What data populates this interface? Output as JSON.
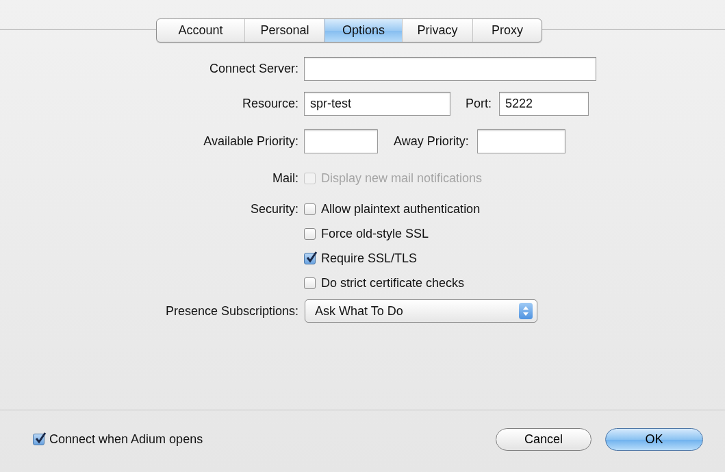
{
  "tabs": [
    {
      "label": "Account",
      "selected": false
    },
    {
      "label": "Personal",
      "selected": false
    },
    {
      "label": "Options",
      "selected": true
    },
    {
      "label": "Privacy",
      "selected": false
    },
    {
      "label": "Proxy",
      "selected": false
    }
  ],
  "connect_server": {
    "label": "Connect Server:"
  },
  "resource": {
    "label": "Resource:",
    "value": "spr-test"
  },
  "port": {
    "label": "Port:",
    "value": "5222"
  },
  "available_priority": {
    "label": "Available Priority:"
  },
  "away_priority": {
    "label": "Away Priority:"
  },
  "mail": {
    "label": "Mail:",
    "options": [
      {
        "label": "Display new mail notifications",
        "checked": false,
        "disabled": true
      }
    ]
  },
  "security": {
    "label": "Security:",
    "options": [
      {
        "label": "Allow plaintext authentication",
        "checked": false,
        "disabled": false
      },
      {
        "label": "Force old-style SSL",
        "checked": false,
        "disabled": false
      },
      {
        "label": "Require SSL/TLS",
        "checked": true,
        "disabled": false
      },
      {
        "label": "Do strict certificate checks",
        "checked": false,
        "disabled": false
      }
    ]
  },
  "presence_subscriptions": {
    "label": "Presence Subscriptions:",
    "value": "Ask What To Do"
  },
  "connect_on_open": {
    "label": "Connect when Adium opens",
    "checked": true
  },
  "buttons": [
    {
      "label": "Cancel",
      "default": false
    },
    {
      "label": "OK",
      "default": true
    }
  ]
}
